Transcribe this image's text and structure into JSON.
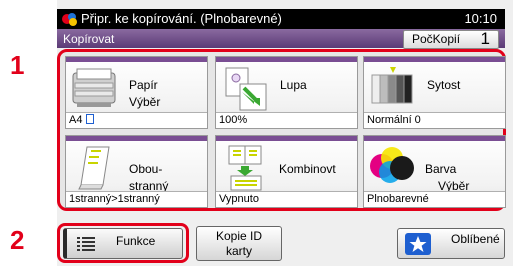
{
  "markers": {
    "one": "1",
    "two": "2"
  },
  "status": {
    "title": "Připr. ke kopírování. (Plnobarevné)",
    "time": "10:10"
  },
  "header": {
    "label": "Kopírovat",
    "copies_label": "PočKopií",
    "copies_value": "1"
  },
  "tiles": [
    {
      "label1": "Papír",
      "label2": "Výběr",
      "value": "A4",
      "icon": "paper-tray-icon"
    },
    {
      "label1": "Lupa",
      "label2": "",
      "value": "100%",
      "icon": "zoom-icon"
    },
    {
      "label1": "Sytost",
      "label2": "",
      "value": "Normální 0",
      "icon": "density-icon"
    },
    {
      "label1": "Obou-",
      "label2": "stranný",
      "value": "1stranný>1stranný",
      "icon": "duplex-icon"
    },
    {
      "label1": "Kombinovt",
      "label2": "",
      "value": "Vypnuto",
      "icon": "combine-icon"
    },
    {
      "label1": "Barva",
      "label2": "Výběr",
      "value": "Plnobarevné",
      "icon": "color-select-icon"
    }
  ],
  "bottom": {
    "functions_label": "Funkce",
    "id_copy_line1": "Kopie ID",
    "id_copy_line2": "karty",
    "favorites_label": "Oblíbené"
  }
}
